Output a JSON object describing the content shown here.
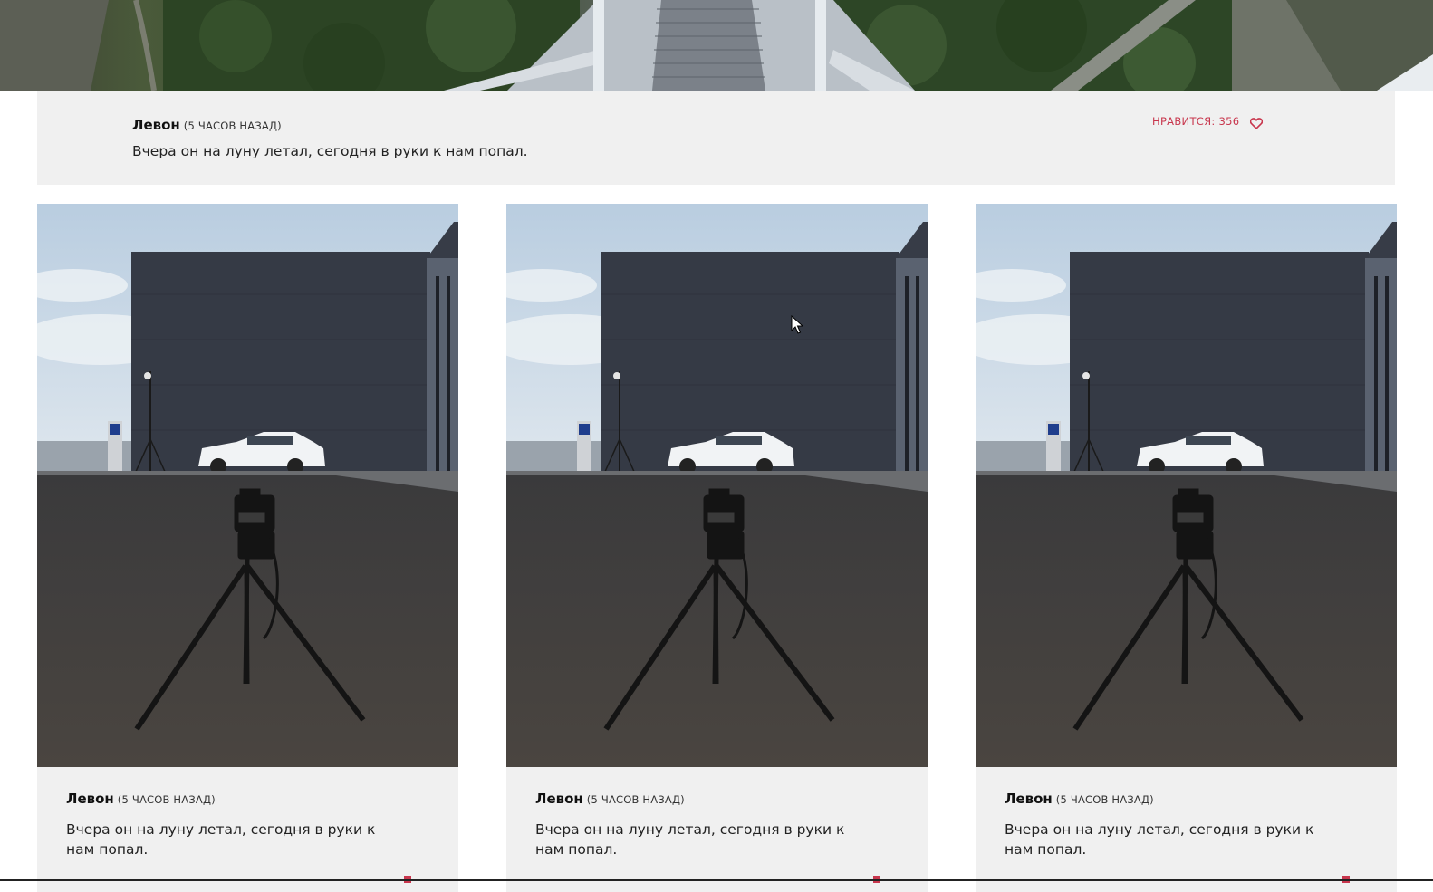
{
  "hero": {
    "image": "bridge-over-forest-photo"
  },
  "featured_post": {
    "author": "Левон",
    "time": "(5 ЧАСОВ НАЗАД)",
    "text": "Вчера он на луну летал, сегодня в руки к нам попал.",
    "likes_label": "НРАВИТСЯ: 356",
    "like_icon": "heart-icon",
    "accent_color": "#c8364d"
  },
  "cards": [
    {
      "image": "tripod-camera-photo",
      "author": "Левон",
      "time": "(5 ЧАСОВ НАЗАД)",
      "text": "Вчера он на луну летал, сегодня в руки к нам попал."
    },
    {
      "image": "tripod-camera-photo",
      "author": "Левон",
      "time": "(5 ЧАСОВ НАЗАД)",
      "text": "Вчера он на луну летал, сегодня в руки к нам попал."
    },
    {
      "image": "tripod-camera-photo",
      "author": "Левон",
      "time": "(5 ЧАСОВ НАЗАД)",
      "text": "Вчера он на луну летал, сегодня в руки к нам попал."
    }
  ],
  "cursor": "arrow-cursor-icon"
}
